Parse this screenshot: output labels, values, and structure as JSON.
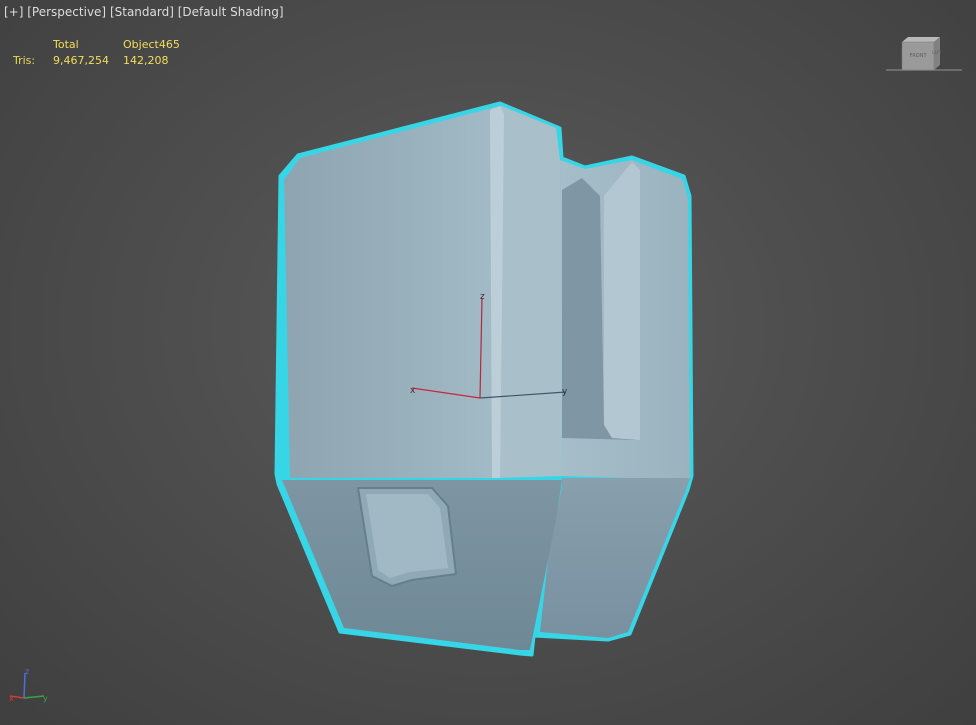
{
  "viewport": {
    "menu_label": "[+]",
    "view_label": "[Perspective]",
    "style_label": "[Standard]",
    "shading_label": "[Default Shading]"
  },
  "stats": {
    "header_total": "Total",
    "header_object": "Object465",
    "row_label": "Tris:",
    "total_tris": "9,467,254",
    "object_tris": "142,208"
  },
  "viewcube": {
    "front_label": "FRONT",
    "side_label": "LEFT"
  },
  "gizmo": {
    "x_label": "x",
    "y_label": "y",
    "z_label": "z"
  },
  "world_axis": {
    "x_label": "x",
    "y_label": "y",
    "z_label": "z"
  },
  "colors": {
    "selection_outline": "#37d6e6",
    "model_face": "#9fb7c3",
    "axis_x": "#c8283a",
    "axis_y": "#3f5866",
    "axis_z": "#b4283a",
    "stats_text": "#f2dd5c"
  }
}
